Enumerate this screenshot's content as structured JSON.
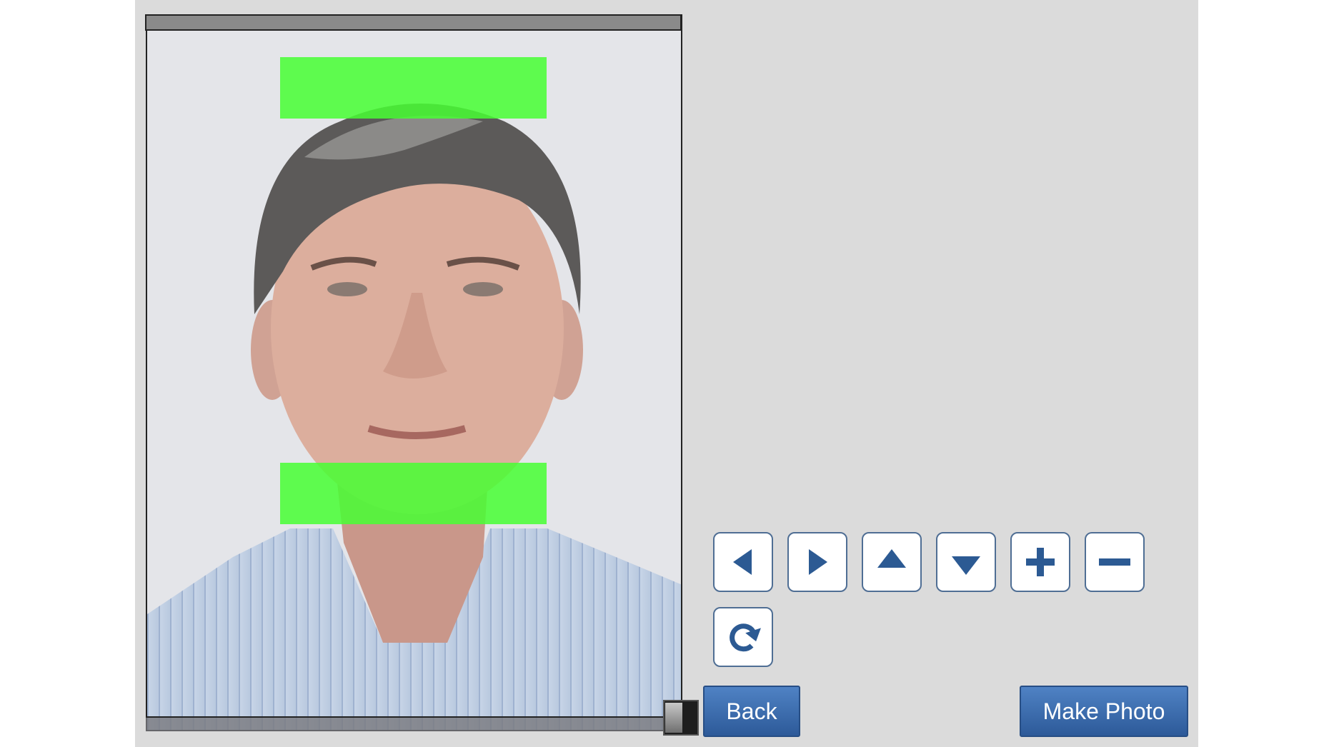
{
  "controls": {
    "move_left": {
      "icon": "arrow-left-icon"
    },
    "move_right": {
      "icon": "arrow-right-icon"
    },
    "move_up": {
      "icon": "arrow-up-icon"
    },
    "move_down": {
      "icon": "arrow-down-icon"
    },
    "zoom_in": {
      "icon": "plus-icon"
    },
    "zoom_out": {
      "icon": "minus-icon"
    },
    "rotate": {
      "icon": "rotate-clockwise-icon"
    }
  },
  "actions": {
    "back_label": "Back",
    "make_photo_label": "Make Photo"
  },
  "colors": {
    "panel_background": "#dbdbdb",
    "guide_bar": "#46ff32",
    "button_blue": "#3a6cb0",
    "icon_blue": "#2c5a93"
  }
}
